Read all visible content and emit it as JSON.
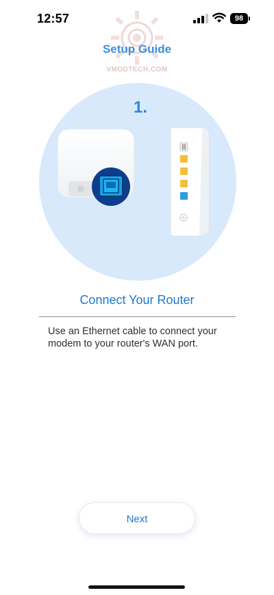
{
  "status_bar": {
    "time": "12:57",
    "battery_level": "98",
    "icons": [
      "cellular-signal-icon",
      "wifi-icon",
      "battery-icon"
    ]
  },
  "watermark": {
    "text": "VMODTECH.COM"
  },
  "header": {
    "title": "Setup Guide"
  },
  "step": {
    "number": "1.",
    "heading": "Connect Your Router",
    "description": "Use an Ethernet cable to connect your modem to your router's WAN port."
  },
  "actions": {
    "next_label": "Next"
  },
  "colors": {
    "accent": "#1d78cf",
    "title_blue": "#3b8fe0",
    "hero_background": "#d7e9fa",
    "port_yellow": "#f2bf3a",
    "port_blue": "#2e9ae0"
  }
}
